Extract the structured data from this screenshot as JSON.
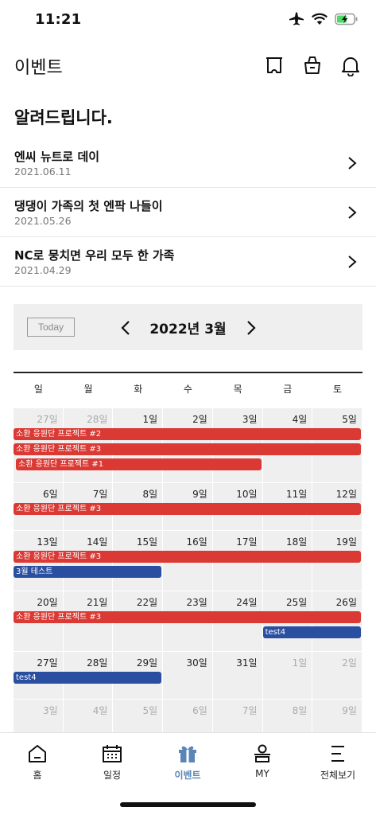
{
  "status": {
    "time": "11:21"
  },
  "header": {
    "title": "이벤트"
  },
  "notice": {
    "title": "알려드립니다.",
    "items": [
      {
        "title": "엔씨 뉴트로 데이",
        "date": "2021.06.11"
      },
      {
        "title": "댕댕이 가족의 첫 엔팍 나들이",
        "date": "2021.05.26"
      },
      {
        "title": "NC로 뭉치면 우리 모두 한 가족",
        "date": "2021.04.29"
      }
    ]
  },
  "calendar": {
    "today_label": "Today",
    "month_label": "2022년 3월",
    "weekdays": [
      "일",
      "월",
      "화",
      "수",
      "목",
      "금",
      "토"
    ],
    "weeks": [
      {
        "days": [
          {
            "label": "27일",
            "out": true
          },
          {
            "label": "28일",
            "out": true
          },
          {
            "label": "1일",
            "out": false
          },
          {
            "label": "2일",
            "out": false
          },
          {
            "label": "3일",
            "out": false
          },
          {
            "label": "4일",
            "out": false
          },
          {
            "label": "5일",
            "out": false
          }
        ],
        "events": [
          {
            "title": "소환 응원단 프로젝트 #2",
            "color": "red",
            "start": 0,
            "end": 6,
            "row": 0
          },
          {
            "title": "소환 응원단 프로젝트 #3",
            "color": "red",
            "start": 0,
            "end": 6,
            "row": 1
          },
          {
            "title": "소환 응원단 프로젝트 #1",
            "color": "red",
            "start": 0,
            "end": 4,
            "row": 2
          }
        ]
      },
      {
        "days": [
          {
            "label": "6일",
            "out": false
          },
          {
            "label": "7일",
            "out": false
          },
          {
            "label": "8일",
            "out": false
          },
          {
            "label": "9일",
            "out": false
          },
          {
            "label": "10일",
            "out": false
          },
          {
            "label": "11일",
            "out": false
          },
          {
            "label": "12일",
            "out": false
          }
        ],
        "events": [
          {
            "title": "소환 응원단 프로젝트 #3",
            "color": "red",
            "start": 0,
            "end": 6,
            "row": 0
          }
        ]
      },
      {
        "days": [
          {
            "label": "13일",
            "out": false
          },
          {
            "label": "14일",
            "out": false
          },
          {
            "label": "15일",
            "out": false
          },
          {
            "label": "16일",
            "out": false
          },
          {
            "label": "17일",
            "out": false
          },
          {
            "label": "18일",
            "out": false
          },
          {
            "label": "19일",
            "out": false
          }
        ],
        "events": [
          {
            "title": "소환 응원단 프로젝트 #3",
            "color": "red",
            "start": 0,
            "end": 6,
            "row": 0
          },
          {
            "title": "3월 테스트",
            "color": "blue",
            "start": 0,
            "end": 2,
            "row": 1
          }
        ]
      },
      {
        "days": [
          {
            "label": "20일",
            "out": false
          },
          {
            "label": "21일",
            "out": false
          },
          {
            "label": "22일",
            "out": false
          },
          {
            "label": "23일",
            "out": false
          },
          {
            "label": "24일",
            "out": false
          },
          {
            "label": "25일",
            "out": false
          },
          {
            "label": "26일",
            "out": false
          }
        ],
        "events": [
          {
            "title": "소환 응원단 프로젝트 #3",
            "color": "red",
            "start": 0,
            "end": 6,
            "row": 0
          },
          {
            "title": "test4",
            "color": "blue",
            "start": 5,
            "end": 6,
            "row": 1
          }
        ]
      },
      {
        "days": [
          {
            "label": "27일",
            "out": false
          },
          {
            "label": "28일",
            "out": false
          },
          {
            "label": "29일",
            "out": false
          },
          {
            "label": "30일",
            "out": false
          },
          {
            "label": "31일",
            "out": false
          },
          {
            "label": "1일",
            "out": true
          },
          {
            "label": "2일",
            "out": true
          }
        ],
        "events": [
          {
            "title": "test4",
            "color": "blue",
            "start": 0,
            "end": 2,
            "row": 0
          }
        ]
      },
      {
        "days": [
          {
            "label": "3일",
            "out": true
          },
          {
            "label": "4일",
            "out": true
          },
          {
            "label": "5일",
            "out": true
          },
          {
            "label": "6일",
            "out": true
          },
          {
            "label": "7일",
            "out": true
          },
          {
            "label": "8일",
            "out": true
          },
          {
            "label": "9일",
            "out": true
          }
        ],
        "events": []
      }
    ]
  },
  "nav": {
    "items": [
      {
        "label": "홈",
        "icon": "home-icon",
        "active": false
      },
      {
        "label": "일정",
        "icon": "calendar-icon",
        "active": false
      },
      {
        "label": "이벤트",
        "icon": "gift-icon",
        "active": true
      },
      {
        "label": "MY",
        "icon": "user-icon",
        "active": false
      },
      {
        "label": "전체보기",
        "icon": "menu-icon",
        "active": false
      }
    ]
  },
  "colors": {
    "event_red": "#db3a34",
    "event_blue": "#2a4fa0",
    "active_nav": "#5a86b6",
    "battery": "#4cd964"
  }
}
